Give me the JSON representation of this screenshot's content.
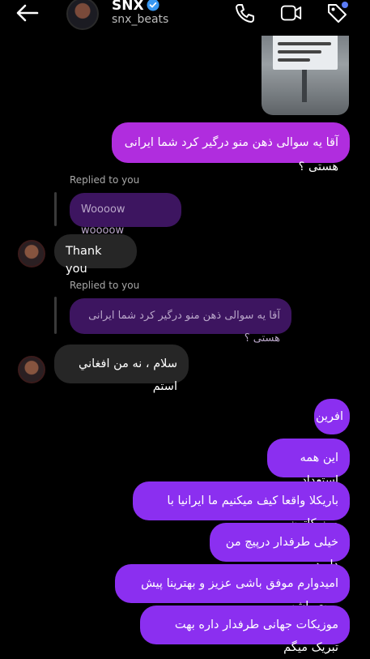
{
  "header": {
    "name": "SNX",
    "handle": "snx_beats"
  },
  "messages": {
    "m1": "آقا یه سوالی ذهن منو درگیر کرد شما ایرانی هستی ؟",
    "reply1_label": "Replied to you",
    "reply1_quote": "Woooow woooow",
    "m2": "Thank you",
    "reply2_label": "Replied to you",
    "reply2_quote": "آقا یه سوالی ذهن منو درگیر کرد شما ایرانی هستی ؟",
    "m3": "سلام ، نه من افغاني استم",
    "o1": "افرین",
    "o2": "این همه استعداد",
    "o3": "باریکلا واقعا کیف میکنیم ما ایرانیا با موزیکاتون",
    "o4": "خیلی طرفدار درپیچ من دارید",
    "o5": "امیدوارم موفق باشی عزیز و بهترینا پیش روت باشه",
    "o6": "موزیکات جهانی طرفدار داره بهت تبریک میگم"
  },
  "colors": {
    "background": "#000000",
    "outgoing_bubble": "#8b2ff0",
    "incoming_bubble": "#262626",
    "verified": "#3897f0"
  }
}
